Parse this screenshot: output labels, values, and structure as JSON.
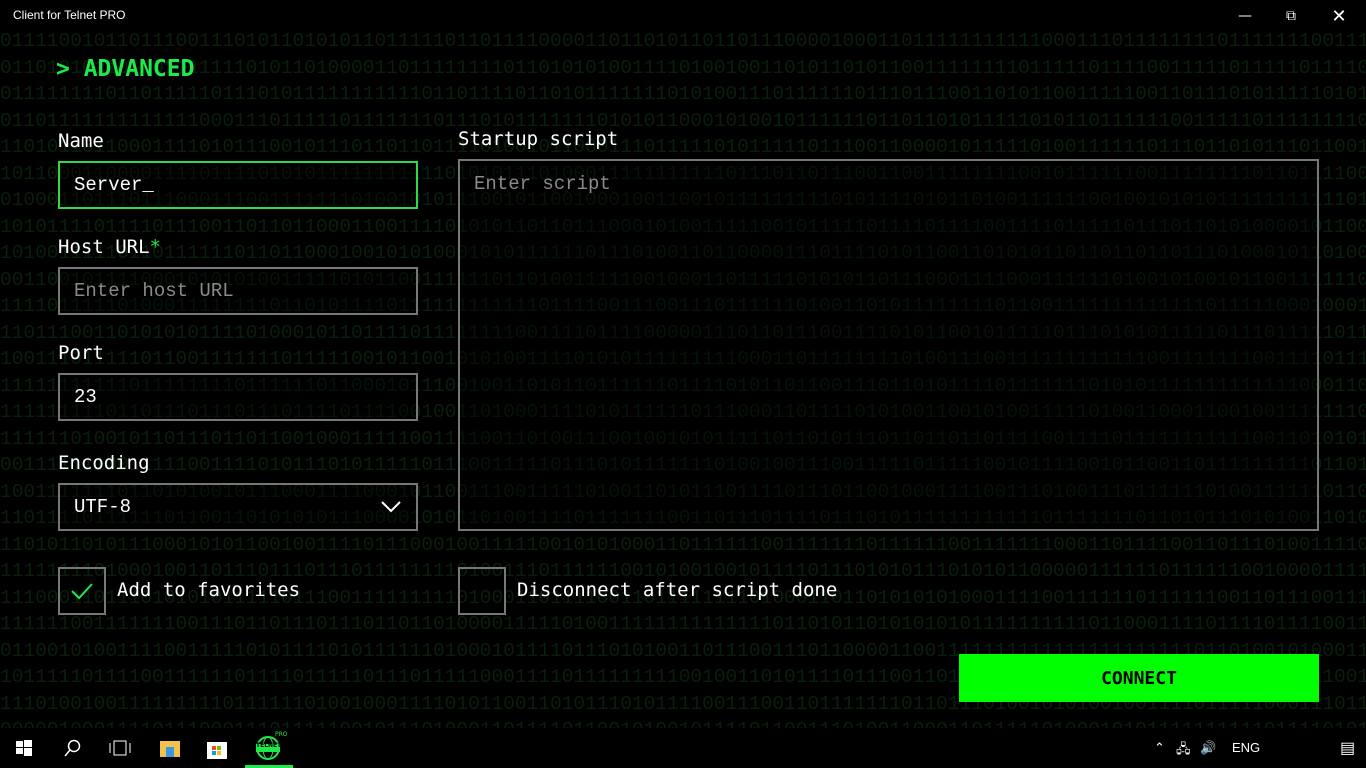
{
  "window": {
    "title": "Client for Telnet PRO"
  },
  "page": {
    "heading": "> ADVANCED"
  },
  "form": {
    "name": {
      "label": "Name",
      "value": "Server_"
    },
    "host": {
      "label": "Host URL",
      "required_mark": "*",
      "placeholder": "Enter host URL"
    },
    "port": {
      "label": "Port",
      "value": "23"
    },
    "encoding": {
      "label": "Encoding",
      "value": "UTF-8"
    },
    "script": {
      "label": "Startup script",
      "placeholder": "Enter script"
    },
    "favorites": {
      "label": "Add to favorites",
      "checked": true
    },
    "disconnect": {
      "label": "Disconnect after script done",
      "checked": false
    },
    "connect_label": "CONNECT"
  },
  "taskbar": {
    "language": "ENG",
    "app_badge": "PRO",
    "app_label": "TELNET"
  },
  "colors": {
    "accent": "#1ee84a",
    "button": "#00ff00",
    "background": "#000000"
  }
}
